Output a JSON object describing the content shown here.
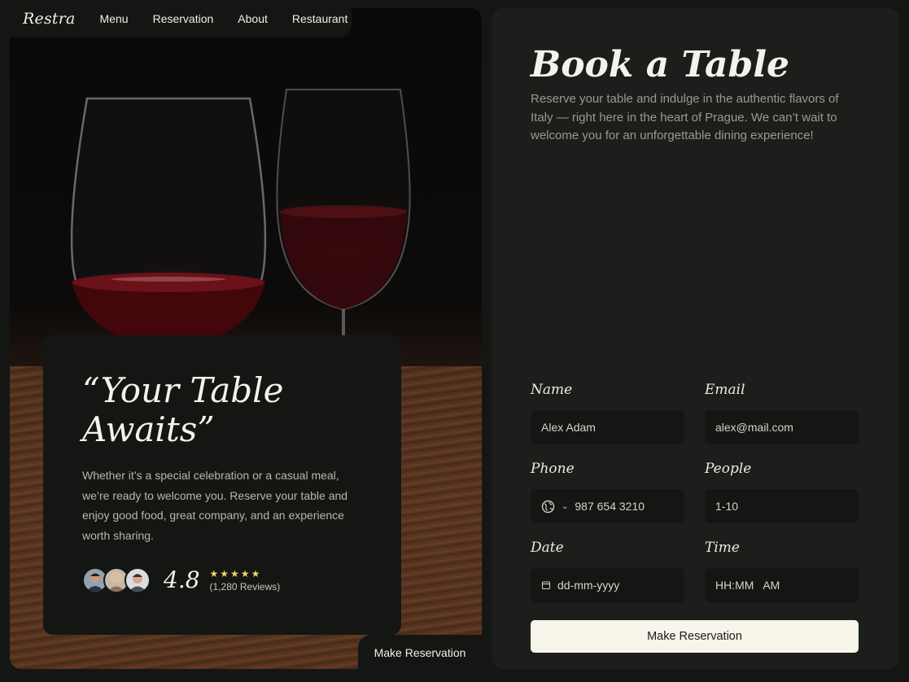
{
  "nav": {
    "logo": "Restra",
    "items": [
      "Menu",
      "Reservation",
      "About",
      "Restaurant"
    ]
  },
  "hero": {
    "quote_line1": "“Your Table",
    "quote_line2": "Awaits”",
    "description": "Whether it’s a special celebration or a casual meal, we’re ready to welcome you. Reserve your table and enjoy good food, great company, and an experience worth sharing.",
    "rating": "4.8",
    "stars": "★★★★★",
    "stars_value": 5,
    "reviews": "(1,280 Reviews)",
    "bottom_tab_label": "Make Reservation"
  },
  "booking": {
    "title": "Book a Table",
    "description": "Reserve your table and indulge in the authentic flavors of Italy — right here in the heart of Prague. We can’t wait to welcome you for an unforgettable dining experience!",
    "fields": {
      "name": {
        "label": "Name",
        "value": "Alex Adam"
      },
      "email": {
        "label": "Email",
        "value": "alex@mail.com"
      },
      "phone": {
        "label": "Phone",
        "value": "987 654 3210"
      },
      "people": {
        "label": "People",
        "value": "1-10"
      },
      "date": {
        "label": "Date",
        "value": "dd-mm-yyyy"
      },
      "time": {
        "label": "Time",
        "value": "HH:MM   AM"
      }
    },
    "submit_label": "Make Reservation"
  },
  "colors": {
    "background": "#141613",
    "panel": "#1c1e1b",
    "button": "#f7f4ea",
    "star": "#f3d36b"
  }
}
